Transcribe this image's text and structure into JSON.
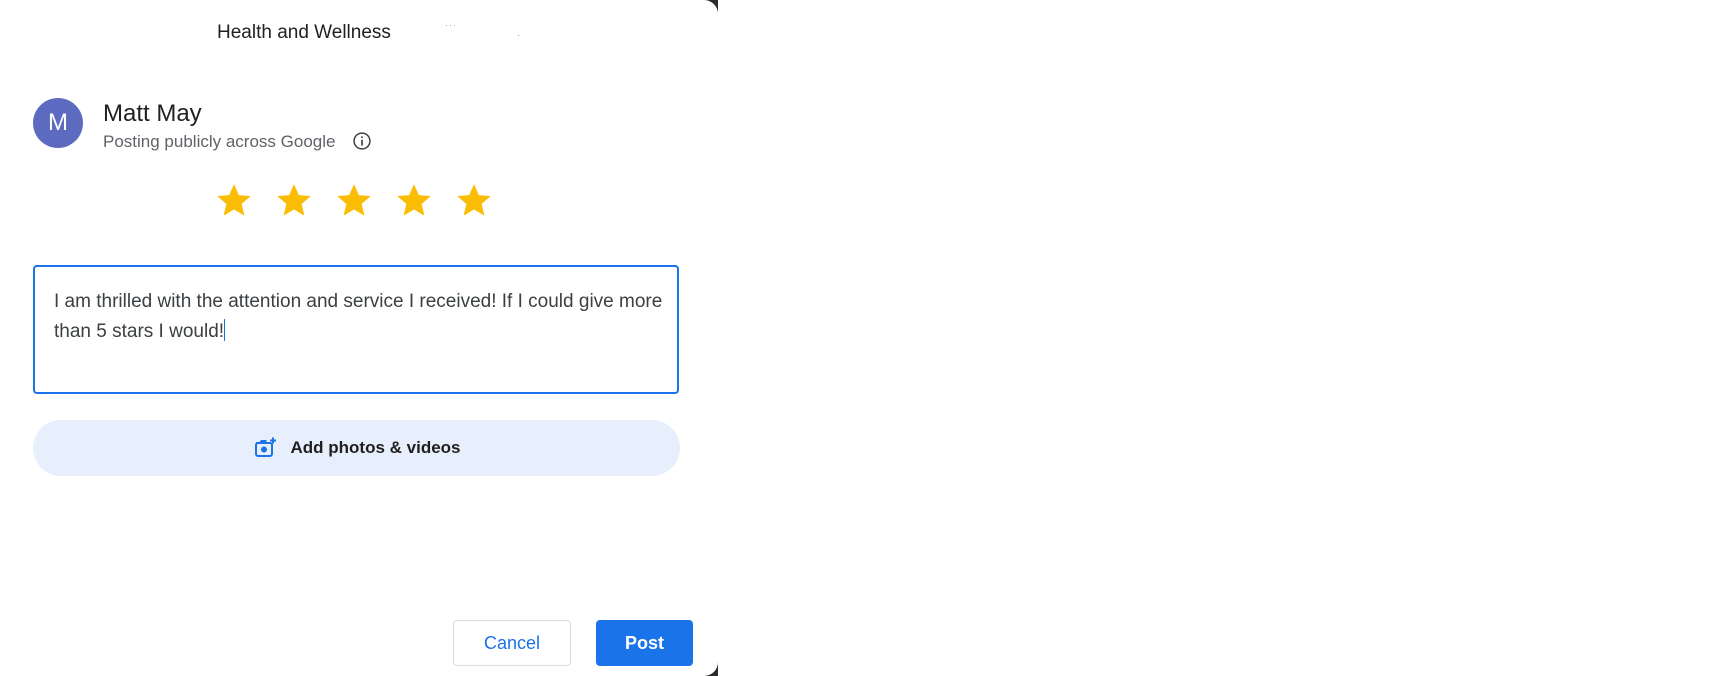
{
  "header": {
    "business_name": "Health and Wellness",
    "redacted_mark": "···",
    "trailing_dot": "."
  },
  "user": {
    "avatar_letter": "M",
    "name": "Matt May",
    "posting_note": "Posting publicly across Google",
    "avatar_color": "#5c6bc0"
  },
  "rating": {
    "value": 5,
    "max": 5,
    "star_color": "#fbbc04"
  },
  "review": {
    "text": "I am thrilled with the attention and service I received! If I could give more than 5 stars I would!"
  },
  "media": {
    "label": "Add photos & videos",
    "icon": "add-photo-icon"
  },
  "actions": {
    "cancel_label": "Cancel",
    "post_label": "Post",
    "accent_color": "#1a73e8"
  }
}
